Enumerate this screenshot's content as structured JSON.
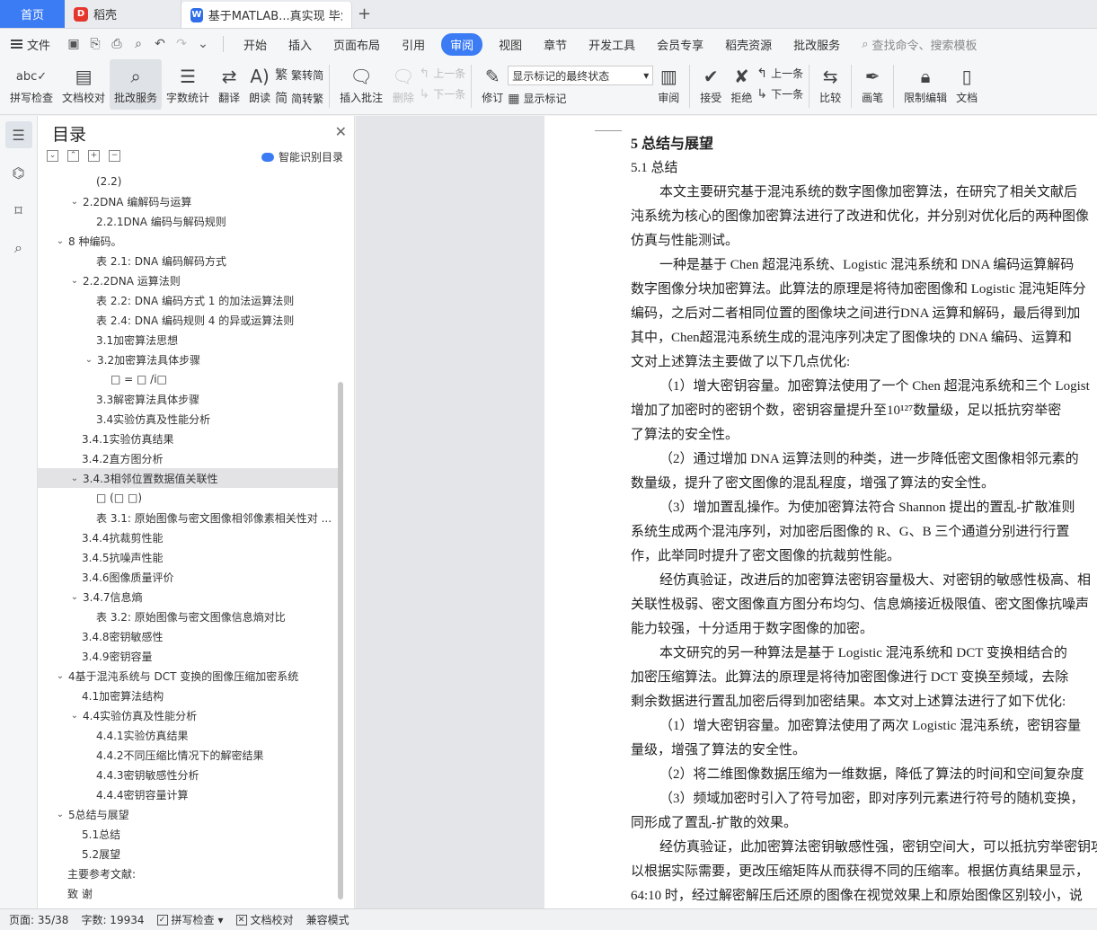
{
  "tabs": {
    "home": "首页",
    "app": "稻壳",
    "doc": "基于MATLAB...真实现 毕业论"
  },
  "menubar": {
    "file": "文件",
    "items": [
      "开始",
      "插入",
      "页面布局",
      "引用",
      "审阅",
      "视图",
      "章节",
      "开发工具",
      "会员专享",
      "稻壳资源",
      "批改服务"
    ],
    "active": "审阅",
    "search": "查找命令、搜索模板"
  },
  "ribbon": {
    "spellcheck": "拼写检查",
    "doc_proof": "文档校对",
    "review_service": "批改服务",
    "word_count": "字数统计",
    "translate": "翻译",
    "read_aloud": "朗读",
    "to_traditional": "繁转简",
    "to_simplified": "简转繁",
    "insert_comment": "插入批注",
    "delete": "删除",
    "prev_comment": "上一条",
    "next_comment": "下一条",
    "track_changes": "修订",
    "markup_select": "显示标记的最终状态",
    "show_markup": "显示标记",
    "review_pane": "审阅",
    "accept": "接受",
    "reject": "拒绝",
    "prev": "上一条",
    "next": "下一条",
    "compare": "比较",
    "pen": "画笔",
    "restrict": "限制编辑",
    "doc_rights": "文档"
  },
  "toc": {
    "title": "目录",
    "smart": "智能识别目录",
    "items": [
      {
        "text": "(2.2)",
        "level": 2,
        "chev": ""
      },
      {
        "text": "2.2DNA 编解码与运算",
        "level": 1,
        "chev": "v"
      },
      {
        "text": "2.2.1DNA 编码与解码规则",
        "level": 2,
        "chev": ""
      },
      {
        "text": "8 种编码。",
        "level": 0,
        "chev": "v"
      },
      {
        "text": "表 2.1:  DNA 编码解码方式",
        "level": 2,
        "chev": ""
      },
      {
        "text": "2.2.2DNA 运算法则",
        "level": 1,
        "chev": "v"
      },
      {
        "text": "表 2.2:  DNA 编码方式 1 的加法运算法则",
        "level": 2,
        "chev": ""
      },
      {
        "text": "表 2.4:  DNA 编码规则 4 的异或运算法则",
        "level": 2,
        "chev": ""
      },
      {
        "text": "3.1加密算法思想",
        "level": 2,
        "chev": ""
      },
      {
        "text": "3.2加密算法具体步骤",
        "level": 2,
        "chev": "v"
      },
      {
        "text": "□ = □   /i□",
        "level": 3,
        "chev": ""
      },
      {
        "text": "3.3解密算法具体步骤",
        "level": 2,
        "chev": ""
      },
      {
        "text": "3.4实验仿真及性能分析",
        "level": 2,
        "chev": ""
      },
      {
        "text": "3.4.1实验仿真结果",
        "level": 1,
        "chev": ""
      },
      {
        "text": "3.4.2直方图分析",
        "level": 1,
        "chev": ""
      },
      {
        "text": "3.4.3相邻位置数据值关联性",
        "level": 1,
        "chev": "v",
        "selected": true
      },
      {
        "text": "□   (□ □)",
        "level": 2,
        "chev": ""
      },
      {
        "text": "表 3.1:  原始图像与密文图像相邻像素相关性对 ...",
        "level": 2,
        "chev": ""
      },
      {
        "text": "3.4.4抗裁剪性能",
        "level": 1,
        "chev": ""
      },
      {
        "text": "3.4.5抗噪声性能",
        "level": 1,
        "chev": ""
      },
      {
        "text": "3.4.6图像质量评价",
        "level": 1,
        "chev": ""
      },
      {
        "text": "3.4.7信息熵",
        "level": 1,
        "chev": "v"
      },
      {
        "text": "表 3.2:  原始图像与密文图像信息熵对比",
        "level": 2,
        "chev": ""
      },
      {
        "text": "3.4.8密钥敏感性",
        "level": 1,
        "chev": ""
      },
      {
        "text": "3.4.9密钥容量",
        "level": 1,
        "chev": ""
      },
      {
        "text": "4基于混沌系统与 DCT 变换的图像压缩加密系统",
        "level": 0,
        "chev": "v"
      },
      {
        "text": "4.1加密算法结构",
        "level": 1,
        "chev": ""
      },
      {
        "text": "4.4实验仿真及性能分析",
        "level": 1,
        "chev": "v"
      },
      {
        "text": "4.4.1实验仿真结果",
        "level": 2,
        "chev": ""
      },
      {
        "text": "4.4.2不同压缩比情况下的解密结果",
        "level": 2,
        "chev": ""
      },
      {
        "text": "4.4.3密钥敏感性分析",
        "level": 2,
        "chev": ""
      },
      {
        "text": "4.4.4密钥容量计算",
        "level": 2,
        "chev": ""
      },
      {
        "text": "5总结与展望",
        "level": 0,
        "chev": "v"
      },
      {
        "text": "5.1总结",
        "level": 1,
        "chev": ""
      },
      {
        "text": "5.2展望",
        "level": 1,
        "chev": ""
      },
      {
        "text": "主要参考文献:",
        "level": 0,
        "chev": ""
      },
      {
        "text": "致 谢",
        "level": 0,
        "chev": ""
      }
    ]
  },
  "document": {
    "lines": [
      {
        "text": "5    总结与展望",
        "type": "h1"
      },
      {
        "text": "5.1    总结",
        "type": "h2"
      },
      {
        "text": "本文主要研究基于混沌系统的数字图像加密算法，在研究了相关文献后",
        "type": "indent"
      },
      {
        "text": "沌系统为核心的图像加密算法进行了改进和优化，并分别对优化后的两种图像",
        "type": "body"
      },
      {
        "text": "仿真与性能测试。",
        "type": "body"
      },
      {
        "text": "一种是基于 Chen 超混沌系统、Logistic 混沌系统和 DNA 编码运算解码",
        "type": "indent"
      },
      {
        "text": "数字图像分块加密算法。此算法的原理是将待加密图像和 Logistic 混沌矩阵分",
        "type": "body"
      },
      {
        "text": "编码，之后对二者相同位置的图像块之间进行DNA 运算和解码，最后得到加",
        "type": "body"
      },
      {
        "text": "其中，Chen超混沌系统生成的混沌序列决定了图像块的 DNA 编码、运算和",
        "type": "body"
      },
      {
        "text": "文对上述算法主要做了以下几点优化:",
        "type": "body"
      },
      {
        "text": "（1）增大密钥容量。加密算法使用了一个 Chen 超混沌系统和三个 Logist",
        "type": "indent"
      },
      {
        "text": "增加了加密时的密钥个数，密钥容量提升至10¹²⁷数量级，足以抵抗穷举密",
        "type": "body"
      },
      {
        "text": "了算法的安全性。",
        "type": "body"
      },
      {
        "text": "（2）通过增加 DNA 运算法则的种类，进一步降低密文图像相邻元素的",
        "type": "indent"
      },
      {
        "text": "数量级，提升了密文图像的混乱程度，增强了算法的安全性。",
        "type": "body"
      },
      {
        "text": "（3）增加置乱操作。为使加密算法符合 Shannon 提出的置乱-扩散准则",
        "type": "indent"
      },
      {
        "text": "系统生成两个混沌序列，对加密后图像的 R、G、B 三个通道分别进行行置",
        "type": "body"
      },
      {
        "text": "作，此举同时提升了密文图像的抗裁剪性能。",
        "type": "body"
      },
      {
        "text": "经仿真验证，改进后的加密算法密钥容量极大、对密钥的敏感性极高、相",
        "type": "indent"
      },
      {
        "text": "关联性极弱、密文图像直方图分布均匀、信息熵接近极限值、密文图像抗噪声",
        "type": "body"
      },
      {
        "text": "能力较强，十分适用于数字图像的加密。",
        "type": "body"
      },
      {
        "text": "本文研究的另一种算法是基于 Logistic 混沌系统和 DCT 变换相结合的",
        "type": "indent"
      },
      {
        "text": "加密压缩算法。此算法的原理是将待加密图像进行 DCT 变换至频域，去除",
        "type": "body"
      },
      {
        "text": "剩余数据进行置乱加密后得到加密结果。本文对上述算法进行了如下优化:",
        "type": "body"
      },
      {
        "text": "（1）增大密钥容量。加密算法使用了两次 Logistic 混沌系统，密钥容量",
        "type": "indent"
      },
      {
        "text": "量级，增强了算法的安全性。",
        "type": "body"
      },
      {
        "text": "（2）将二维图像数据压缩为一维数据，降低了算法的时间和空间复杂度",
        "type": "indent"
      },
      {
        "text": "（3）频域加密时引入了符号加密，即对序列元素进行符号的随机变换，",
        "type": "indent"
      },
      {
        "text": "同形成了置乱-扩散的效果。",
        "type": "body"
      },
      {
        "text": "经仿真验证，此加密算法密钥敏感性强，密钥空间大，可以抵抗穷举密钥攻",
        "type": "indent"
      },
      {
        "text": "以根据实际需要，更改压缩矩阵从而获得不同的压缩率。根据仿真结果显示，",
        "type": "body"
      },
      {
        "text": "64:10 时，经过解密解压后还原的图像在视觉效果上和原始图像区别较小，说",
        "type": "body"
      }
    ]
  },
  "status": {
    "page": "页面: 35/38",
    "words": "字数: 19934",
    "spell": "拼写检查",
    "proof": "文档校对",
    "compat": "兼容模式"
  }
}
